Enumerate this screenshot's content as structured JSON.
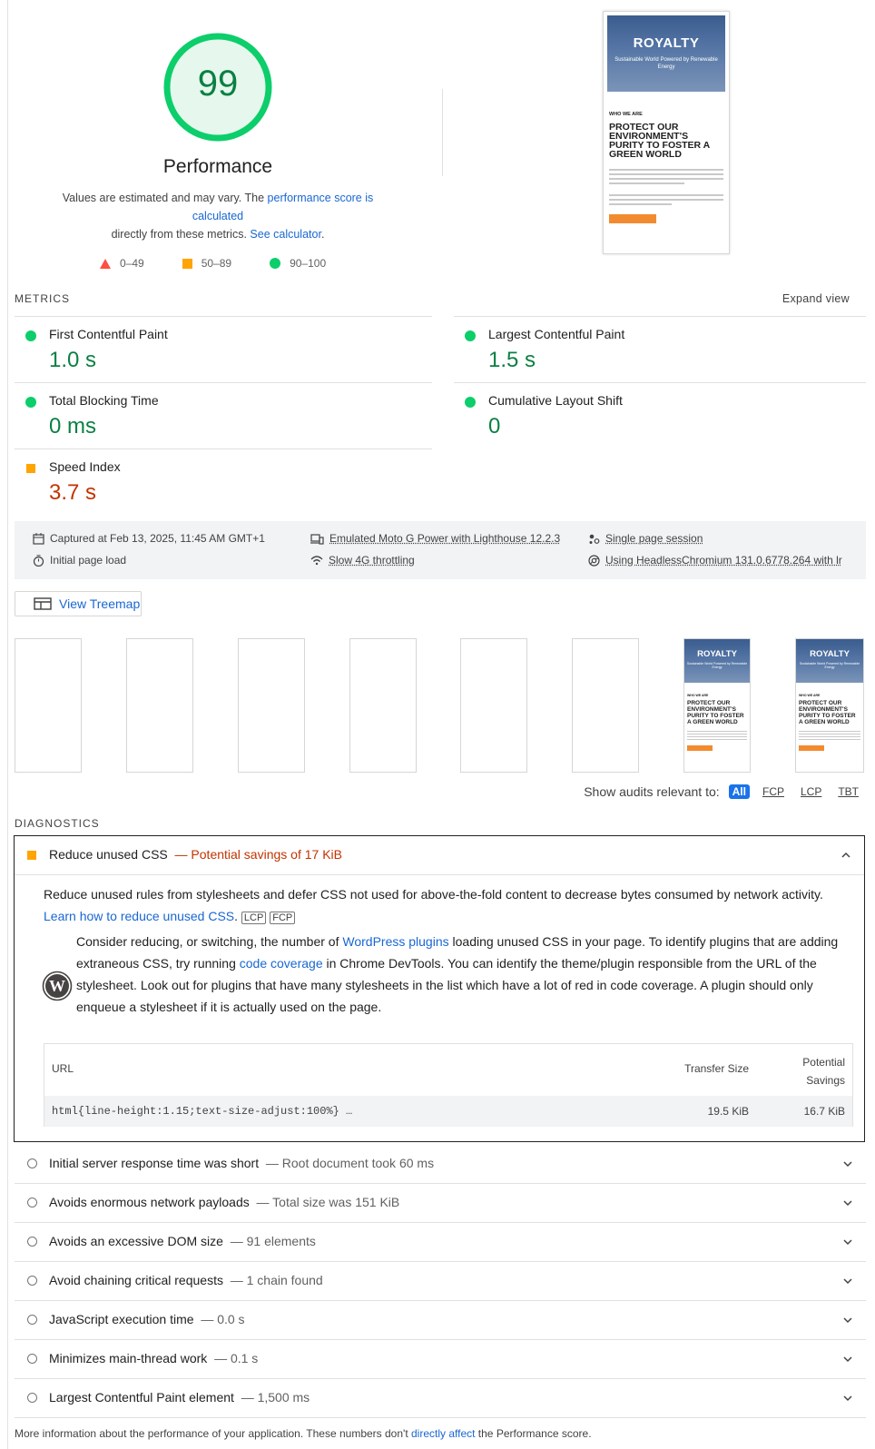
{
  "score": {
    "value": "99",
    "title": "Performance",
    "desc_pre": "Values are estimated and may vary. The ",
    "desc_link1": "performance score is calculated",
    "desc_mid": "directly from these metrics. ",
    "desc_link2": "See calculator",
    "desc_post": ".",
    "legend": [
      "0–49",
      "50–89",
      "90–100"
    ]
  },
  "final_screenshot": {
    "title": "ROYALTY",
    "subtitle": "Sustainable World Powered by Renewable Energy",
    "eyebrow": "WHO WE ARE",
    "heading": "PROTECT OUR ENVIRONMENT'S PURITY TO FOSTER A GREEN WORLD"
  },
  "metrics": {
    "heading": "METRICS",
    "expand": "Expand view",
    "items": [
      {
        "name": "First Contentful Paint",
        "value": "1.0 s",
        "status": "pass"
      },
      {
        "name": "Largest Contentful Paint",
        "value": "1.5 s",
        "status": "pass"
      },
      {
        "name": "Total Blocking Time",
        "value": "0 ms",
        "status": "pass"
      },
      {
        "name": "Cumulative Layout Shift",
        "value": "0",
        "status": "pass"
      },
      {
        "name": "Speed Index",
        "value": "3.7 s",
        "status": "average"
      }
    ]
  },
  "env": {
    "captured": "Captured at Feb 13, 2025, 11:45 AM GMT+1",
    "initial": "Initial page load",
    "device": "Emulated Moto G Power with Lighthouse 12.2.3",
    "throttle": "Slow 4G throttling",
    "session": "Single page session",
    "browser": "Using HeadlessChromium 131.0.6778.264 with lr"
  },
  "treemap_label": "View Treemap",
  "filter": {
    "label": "Show audits relevant to:",
    "chips": [
      "All",
      "FCP",
      "LCP",
      "TBT"
    ]
  },
  "diagnostics": {
    "heading": "DIAGNOSTICS",
    "open_audit": {
      "title": "Reduce unused CSS",
      "savings": "— Potential savings of 17 KiB",
      "desc": "Reduce unused rules from stylesheets and defer CSS not used for above-the-fold content to decrease bytes consumed by network activity. ",
      "learn": "Learn how to reduce unused CSS",
      "tags": [
        "LCP",
        "FCP"
      ],
      "stack_pre": "Consider reducing, or switching, the number of ",
      "stack_link1": "WordPress plugins",
      "stack_mid1": " loading unused CSS in your page. To identify plugins that are adding extraneous CSS, try running ",
      "stack_link2": "code coverage",
      "stack_post": " in Chrome DevTools. You can identify the theme/plugin responsible from the URL of the stylesheet. Look out for plugins that have many stylesheets in the list which have a lot of red in code coverage. A plugin should only enqueue a stylesheet if it is actually used on the page.",
      "table": {
        "col_url": "URL",
        "col_transfer": "Transfer Size",
        "col_savings_1": "Potential",
        "col_savings_2": "Savings",
        "row_url": "html{line-height:1.15;text-size-adjust:100%} …",
        "row_transfer": "19.5 KiB",
        "row_savings": "16.7 KiB"
      }
    },
    "audits": [
      {
        "title": "Initial server response time was short",
        "display": "— Root document took 60 ms"
      },
      {
        "title": "Avoids enormous network payloads",
        "display": "— Total size was 151 KiB"
      },
      {
        "title": "Avoids an excessive DOM size",
        "display": "— 91 elements"
      },
      {
        "title": "Avoid chaining critical requests",
        "display": "— 1 chain found"
      },
      {
        "title": "JavaScript execution time",
        "display": "— 0.0 s"
      },
      {
        "title": "Minimizes main-thread work",
        "display": "— 0.1 s"
      },
      {
        "title": "Largest Contentful Paint element",
        "display": "— 1,500 ms"
      }
    ]
  },
  "footer": {
    "pre": "More information about the performance of your application. These numbers don't ",
    "link": "directly affect",
    "post": " the Performance score."
  },
  "colors": {
    "pass": "#0cce6b",
    "average": "#ffa400",
    "fail": "#ff4e42",
    "link": "#1967d2"
  }
}
